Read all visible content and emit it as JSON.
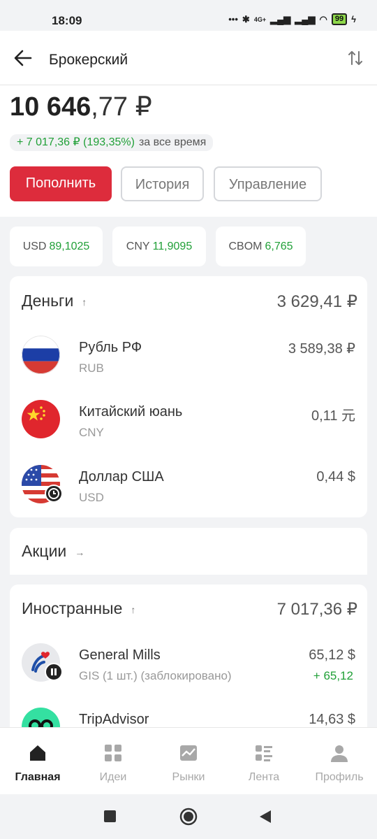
{
  "status_bar": {
    "time": "18:09",
    "network": "4G+",
    "battery": "99"
  },
  "header": {
    "title": "Брокерский"
  },
  "balance": {
    "integer": "10 646",
    "decimal": ",77 ₽"
  },
  "delta": {
    "value": "+ 7 017,36 ₽ (193,35%)",
    "label": "за все время"
  },
  "actions": {
    "topup": "Пополнить",
    "history": "История",
    "manage": "Управление"
  },
  "rates": [
    {
      "code": "USD",
      "value": "89,1025"
    },
    {
      "code": "CNY",
      "value": "11,9095"
    },
    {
      "code": "CBOM",
      "value": "6,765"
    }
  ],
  "money": {
    "title": "Деньги",
    "total": "3 629,41 ₽",
    "items": [
      {
        "name": "Рубль РФ",
        "code": "RUB",
        "amount": "3 589,38 ₽",
        "icon": "russia-flag-icon"
      },
      {
        "name": "Китайский юань",
        "code": "CNY",
        "amount": "0,11 元",
        "icon": "china-flag-icon"
      },
      {
        "name": "Доллар США",
        "code": "USD",
        "amount": "0,44 $",
        "icon": "usa-flag-icon"
      }
    ]
  },
  "stocks": {
    "title": "Акции"
  },
  "foreign": {
    "title": "Иностранные",
    "total": "7 017,36 ₽",
    "items": [
      {
        "name": "General Mills",
        "sub": "GIS (1 шт.) (заблокировано)",
        "amount": "65,12 $",
        "gain": "+ 65,12",
        "icon": "general-mills-logo-icon"
      },
      {
        "name": "TripAdvisor",
        "amount": "14,63 $",
        "icon": "tripadvisor-logo-icon"
      }
    ]
  },
  "tabs": [
    {
      "label": "Главная",
      "icon": "home-icon",
      "active": true
    },
    {
      "label": "Идеи",
      "icon": "grid-icon"
    },
    {
      "label": "Рынки",
      "icon": "chart-icon"
    },
    {
      "label": "Лента",
      "icon": "feed-icon"
    },
    {
      "label": "Профиль",
      "icon": "profile-icon"
    }
  ],
  "colors": {
    "accent": "#dd2c3c",
    "positive": "#21a038"
  }
}
